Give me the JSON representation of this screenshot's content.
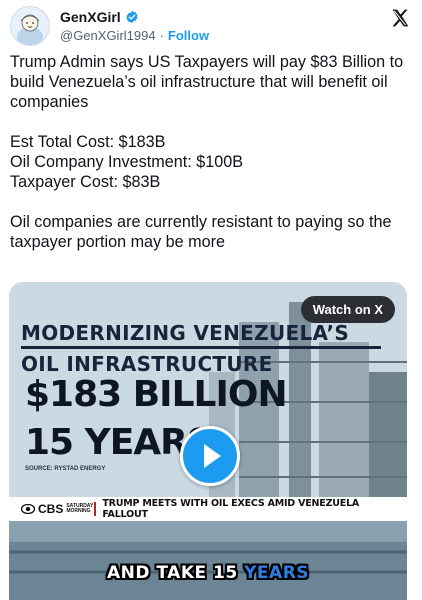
{
  "author": {
    "display_name": "GenXGirl",
    "handle": "@GenXGirl1994",
    "separator": "·",
    "follow_label": "Follow",
    "avatar_icon": "cartoon-avatar-icon",
    "verified_icon": "verified-badge-icon",
    "verified_color": "#1d9bf0"
  },
  "platform_icon": "x-logo-icon",
  "tweet": {
    "paragraphs": [
      "Trump Admin says US Taxpayers will pay $83 Billion to build Venezuela’s oil infrastructure that will benefit oil companies",
      "",
      "Oil companies are currently resistant to paying so the taxpayer portion may be more"
    ],
    "cost_lines": [
      "Est Total Cost: $183B",
      "Oil Company Investment: $100B",
      "Taxpayer Cost: $83B"
    ]
  },
  "media": {
    "watch_label": "Watch on X",
    "headline_line1": "MODERNIZING VENEZUELA’S",
    "headline_line2": "OIL INFRASTRUCTURE",
    "amount": "$183 BILLION",
    "years": "15 YEARS",
    "source": "SOURCE: RYSTAD ENERGY",
    "network_name": "CBS",
    "network_show": "SATURDAY MORNING",
    "lower_headline": "TRUMP MEETS WITH OIL EXECS AMID VENEZUELA FALLOUT",
    "caption_part1": "AND TAKE 15 ",
    "caption_part2": "YEARS",
    "play_icon": "play-icon",
    "accent_color": "#1d9bf0",
    "caption_highlight_color": "#2f7de1"
  }
}
